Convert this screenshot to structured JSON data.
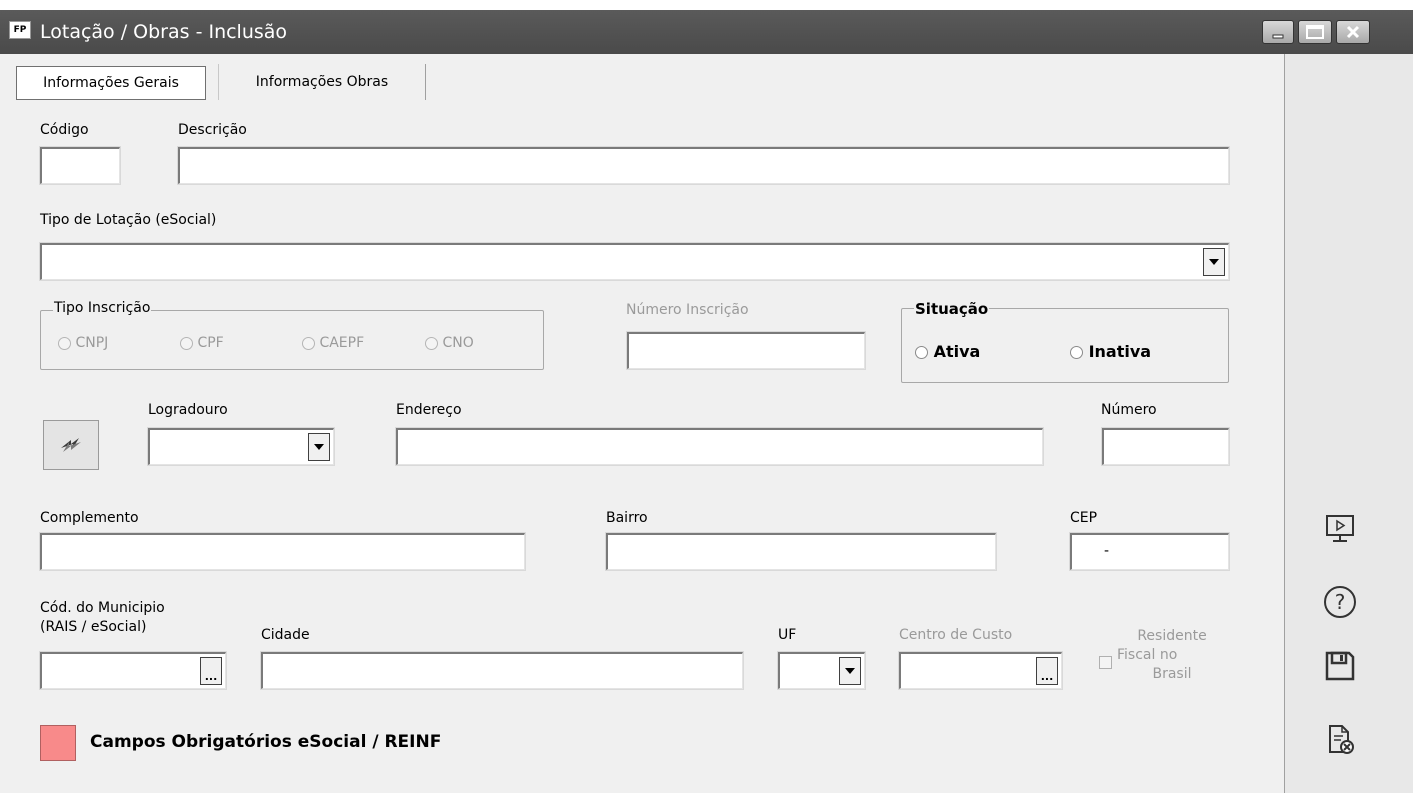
{
  "window": {
    "title": "Lotação / Obras - Inclusão",
    "app_icon_text": "FP"
  },
  "tabs": [
    {
      "label": "Informações Gerais",
      "active": true
    },
    {
      "label": "Informações Obras",
      "active": false
    }
  ],
  "fields": {
    "codigo": {
      "label": "Código",
      "value": ""
    },
    "descricao": {
      "label": "Descrição",
      "value": ""
    },
    "tipo_lotacao": {
      "label": "Tipo de Lotação (eSocial)",
      "value": ""
    },
    "tipo_inscricao": {
      "label": "Tipo Inscrição",
      "options": [
        "CNPJ",
        "CPF",
        "CAEPF",
        "CNO"
      ]
    },
    "numero_inscricao": {
      "label": "Número Inscrição",
      "value": ""
    },
    "situacao": {
      "label": "Situação",
      "options": [
        "Ativa",
        "Inativa"
      ]
    },
    "logradouro": {
      "label": "Logradouro",
      "value": ""
    },
    "endereco": {
      "label": "Endereço",
      "value": ""
    },
    "numero": {
      "label": "Número",
      "value": ""
    },
    "complemento": {
      "label": "Complemento",
      "value": ""
    },
    "bairro": {
      "label": "Bairro",
      "value": ""
    },
    "cep": {
      "label": "CEP",
      "value": "-"
    },
    "cod_municipio": {
      "label_line1": "Cód. do Municipio",
      "label_line2": "(RAIS / eSocial)",
      "value": ""
    },
    "cidade": {
      "label": "Cidade",
      "value": ""
    },
    "uf": {
      "label": "UF",
      "value": ""
    },
    "centro_custo": {
      "label": "Centro de Custo",
      "value": ""
    },
    "residente_fiscal": {
      "label_line1": "Residente",
      "label_line2": "Fiscal no",
      "label_line3": "Brasil"
    }
  },
  "legend": {
    "label": "Campos Obrigatórios eSocial / REINF",
    "color": "#f88a8a"
  },
  "side_buttons": [
    "monitor-play-icon",
    "help-icon",
    "save-icon",
    "cancel-document-icon"
  ]
}
